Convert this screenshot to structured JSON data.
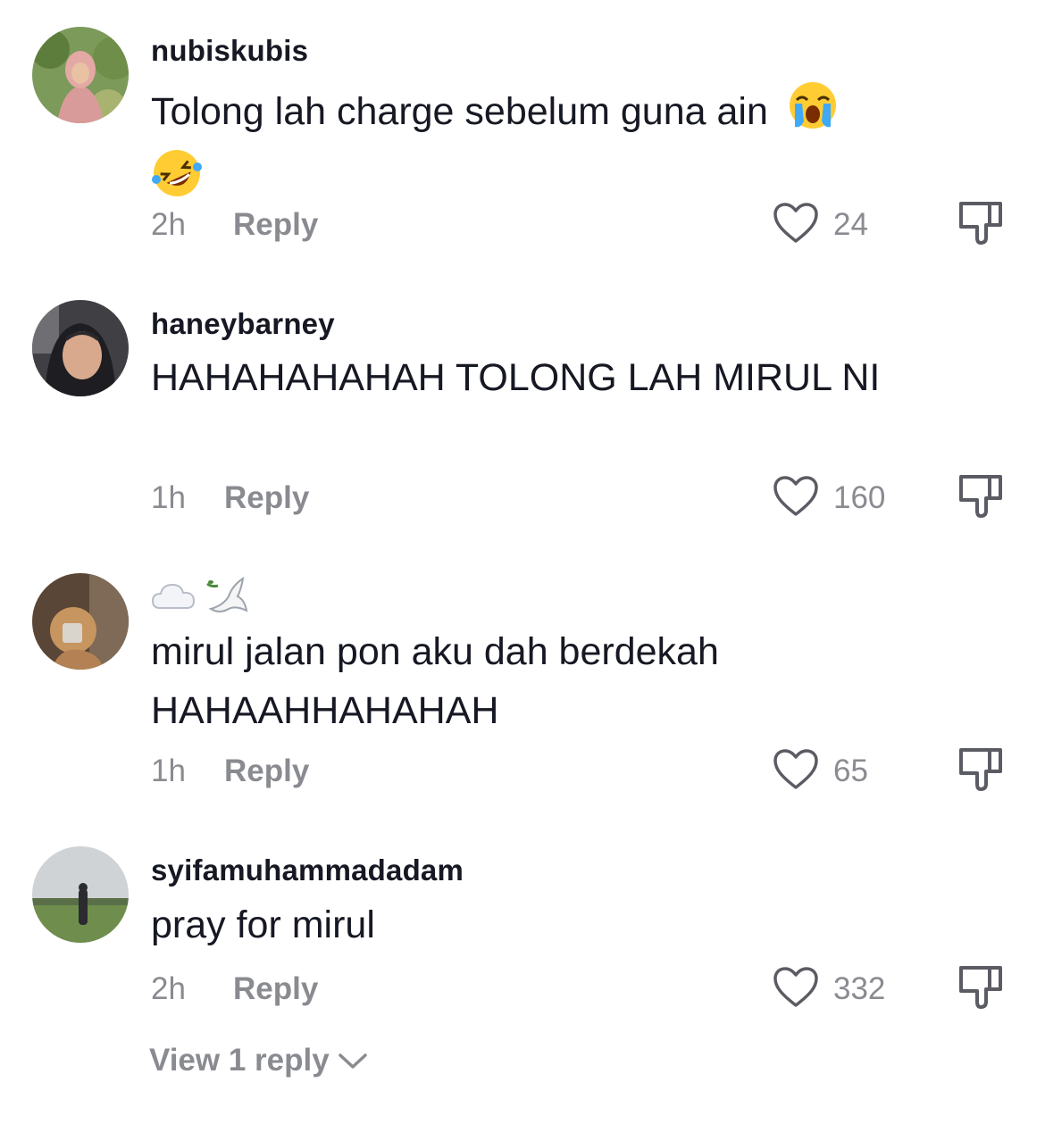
{
  "comments": [
    {
      "username": "nubiskubis",
      "text": "Tolong lah charge sebelum guna ain",
      "text_emojis": [
        "loudly-crying-face",
        "rolling-on-the-floor-laughing"
      ],
      "time": "2h",
      "reply_label": "Reply",
      "likes": "24"
    },
    {
      "username": "haneybarney",
      "text": "HAHAHAHAHAH TOLONG LAH MIRUL NI",
      "time": "1h",
      "reply_label": "Reply",
      "likes": "160"
    },
    {
      "username_emojis": [
        "cloud",
        "dove"
      ],
      "text": "mirul jalan pon aku dah berdekah HAHAAHHAHAHAH",
      "time": "1h",
      "reply_label": "Reply",
      "likes": "65"
    },
    {
      "username": "syifamuhammadadam",
      "text": "pray for mirul",
      "time": "2h",
      "reply_label": "Reply",
      "likes": "332"
    }
  ],
  "view_replies_label": "View 1 reply",
  "icons": {
    "like": "heart-outline-icon",
    "dislike": "thumbs-down-icon",
    "expand": "chevron-down-icon"
  },
  "colors": {
    "text": "#161823",
    "secondary": "#8a8b91"
  }
}
